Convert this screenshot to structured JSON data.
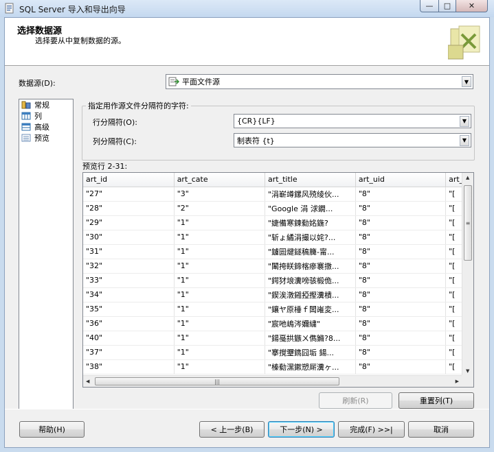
{
  "window": {
    "title": "SQL Server 导入和导出向导",
    "controls": {
      "minimize": "—",
      "maximize": "□",
      "close": "✕"
    }
  },
  "header": {
    "title": "选择数据源",
    "subtitle": "选择要从中复制数据的源。"
  },
  "datasource": {
    "label": "数据源(D):",
    "value": "平面文件源"
  },
  "nav": {
    "items": [
      {
        "label": "常规",
        "icon": "general-icon"
      },
      {
        "label": "列",
        "icon": "columns-icon"
      },
      {
        "label": "高级",
        "icon": "advanced-icon"
      },
      {
        "label": "预览",
        "icon": "preview-icon"
      }
    ]
  },
  "delimiters": {
    "group_title": "指定用作源文件分隔符的字符:",
    "row_label": "行分隔符(O):",
    "row_value": "{CR}{LF}",
    "col_label": "列分隔符(C):",
    "col_value": "制表符 {t}"
  },
  "preview": {
    "label": "预览行 2-31:",
    "columns": [
      "art_id",
      "art_cate",
      "art_title",
      "art_uid",
      "art_"
    ],
    "rows": [
      [
        "\"27\"",
        "\"3\"",
        "\"涓嶄竴鏍风殑绫伙...",
        "\"8\"",
        "\"["
      ],
      [
        "\"28\"",
        "\"2\"",
        "\"Google 涓  浗鐗...",
        "\"8\"",
        "\"["
      ],
      [
        "\"29\"",
        "\"1\"",
        "\"婕備寒鍊勬姳鍦?",
        "\"8\"",
        "\"["
      ],
      [
        "\"30\"",
        "\"1\"",
        "\"斩ょ繘涓撮以姹?...",
        "\"8\"",
        "\"["
      ],
      [
        "\"31\"",
        "\"1\"",
        "\"鐪囩煡鐩稿簲-甯...",
        "\"8\"",
        "\"["
      ],
      [
        "\"32\"",
        "\"1\"",
        "\"闈挎眹鍗楁瘮褰撴...",
        "\"8\"",
        "\"["
      ],
      [
        "\"33\"",
        "\"1\"",
        "\"鍔犲埌瀵嗙骇椴佹...",
        "\"8\"",
        "\"["
      ],
      [
        "\"34\"",
        "\"1\"",
        "\"鍥涘潡鎺掗摼瀵樻...",
        "\"8\"",
        "\"["
      ],
      [
        "\"35\"",
        "\"1\"",
        "\"鑲ヤ原棰ｆ闆嶉変...",
        "\"8\"",
        "\"["
      ],
      [
        "\"36\"",
        "\"1\"",
        "\"宸吔嶋涔嬭繍\"",
        "\"8\"",
        "\"["
      ],
      [
        "\"40\"",
        "\"1\"",
        "\"鍚戞拱鏃ㄨ儁鏅?8...",
        "\"8\"",
        "\"["
      ],
      [
        "\"37\"",
        "\"1\"",
        "\"搴撹瓕鐫囧垢 鍚...",
        "\"8\"",
        "\"["
      ],
      [
        "\"38\"",
        "\"1\"",
        "\"榛勬潶鏉愬厛瀵ヶ...",
        "\"8\"",
        "\"["
      ]
    ]
  },
  "actions": {
    "refresh": "刷新(R)",
    "reset_columns": "重置列(T)"
  },
  "footer": {
    "help": "帮助(H)",
    "back": "< 上一步(B)",
    "next": "下一步(N) >",
    "finish": "完成(F) >>|",
    "cancel": "取消"
  }
}
